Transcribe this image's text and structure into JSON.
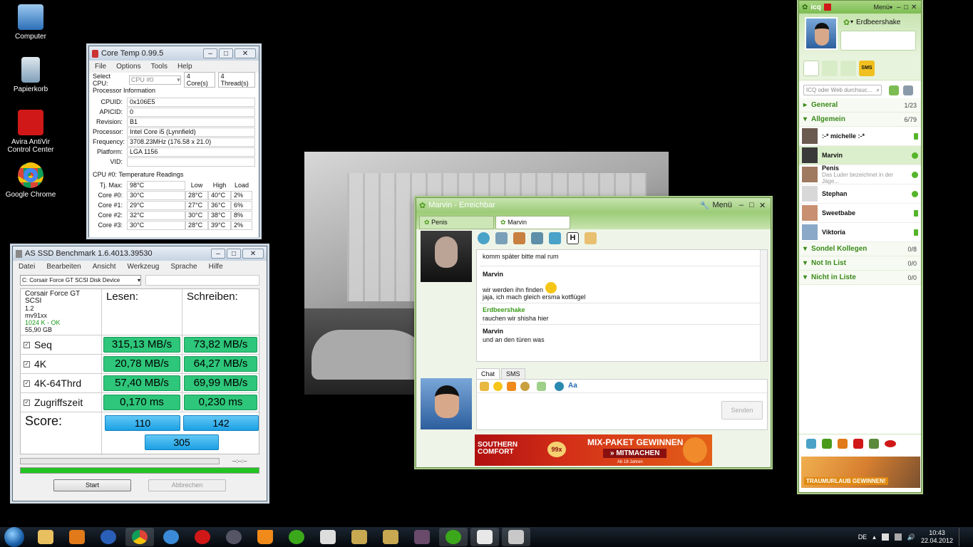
{
  "desktop": {
    "icons": [
      {
        "label": "Computer",
        "color": "#4a90d9"
      },
      {
        "label": "Papierkorb",
        "color": "#7f9fb8"
      },
      {
        "label": "Avira AntiVir Control Center",
        "color": "#d01818"
      },
      {
        "label": "Google Chrome",
        "color": "#e8b414"
      }
    ]
  },
  "coretemp": {
    "title": "Core Temp 0.99.5",
    "menu": [
      "File",
      "Options",
      "Tools",
      "Help"
    ],
    "select_cpu_label": "Select CPU:",
    "cpu_value": "CPU #0",
    "cores_count": "4",
    "cores_label": "Core(s)",
    "threads_count": "4",
    "threads_label": "Thread(s)",
    "processor_info_label": "Processor Information",
    "info": [
      {
        "label": "CPUID:",
        "value": "0x106E5"
      },
      {
        "label": "APICID:",
        "value": "0"
      },
      {
        "label": "Revision:",
        "value": "B1"
      },
      {
        "label": "Processor:",
        "value": "Intel Core i5 (Lynnfield)"
      },
      {
        "label": "Frequency:",
        "value": "3708.23MHz (176.58 x 21.0)"
      },
      {
        "label": "Platform:",
        "value": "LGA 1156"
      },
      {
        "label": "VID:",
        "value": ""
      }
    ],
    "temp_header": "CPU #0: Temperature Readings",
    "tjmax_label": "Tj. Max:",
    "tjmax_value": "98°C",
    "col_low": "Low",
    "col_high": "High",
    "col_load": "Load",
    "cores": [
      {
        "label": "Core #0:",
        "temp": "30°C",
        "low": "28°C",
        "high": "40°C",
        "load": "2%"
      },
      {
        "label": "Core #1:",
        "temp": "29°C",
        "low": "27°C",
        "high": "36°C",
        "load": "6%"
      },
      {
        "label": "Core #2:",
        "temp": "32°C",
        "low": "30°C",
        "high": "38°C",
        "load": "8%"
      },
      {
        "label": "Core #3:",
        "temp": "30°C",
        "low": "28°C",
        "high": "39°C",
        "load": "2%"
      }
    ]
  },
  "asssd": {
    "title": "AS SSD Benchmark 1.6.4013.39530",
    "menu": [
      "Datei",
      "Bearbeiten",
      "Ansicht",
      "Werkzeug",
      "Sprache",
      "Hilfe"
    ],
    "drive_select": "C: Corsair Force GT SCSI Disk Device",
    "drive_info": [
      "Corsair Force GT SCSI",
      "1.2",
      "mv91xx",
      "1024 K - OK",
      "55,90 GB"
    ],
    "col_read": "Lesen:",
    "col_write": "Schreiben:",
    "rows": [
      {
        "label": "Seq",
        "read": "315,13 MB/s",
        "write": "73,82 MB/s"
      },
      {
        "label": "4K",
        "read": "20,78 MB/s",
        "write": "64,27 MB/s"
      },
      {
        "label": "4K-64Thrd",
        "read": "57,40 MB/s",
        "write": "69,99 MB/s"
      },
      {
        "label": "Zugriffszeit",
        "read": "0,170 ms",
        "write": "0,230 ms"
      }
    ],
    "score_label": "Score:",
    "score_read": "110",
    "score_write": "142",
    "score_total": "305",
    "time_display": "--:--:--",
    "progress": 1.0,
    "start_button": "Start",
    "abort_button": "Abbrechen"
  },
  "chat": {
    "title": "Marvin - Erreichbar",
    "menu_label": "Menü",
    "tabs": [
      "Penis",
      "Marvin"
    ],
    "messages": [
      {
        "who": "",
        "text": "komm später bitte mal rum",
        "color": "#000"
      },
      {
        "who": "Marvin",
        "text": "wir werden ihn finden",
        "text2": "jaja, ich mach gleich ersma kotflügel",
        "color": "#000"
      },
      {
        "who": "Erdbeershake",
        "text": "rauchen wir shisha hier",
        "color": "#3c9a1a"
      },
      {
        "who": "Marvin",
        "text": "und an den türen was",
        "color": "#000"
      }
    ],
    "input_tabs": [
      "Chat",
      "SMS"
    ],
    "send_button": "Senden",
    "ad": {
      "brand": "SOUTHERN COMFORT",
      "badge": "99x",
      "headline": "MIX-PAKET GEWINNEN",
      "cta": "» MITMACHEN",
      "fine": "Ab 18 Jahren"
    }
  },
  "icq": {
    "app_name": "icq",
    "menu_label": "Menü",
    "user_name": "Erdbeershake",
    "search_placeholder": "ICQ oder Web durchsuc...",
    "groups": [
      {
        "name": "General",
        "count": "1/23",
        "expanded": false
      },
      {
        "name": "Allgemein",
        "count": "6/79",
        "expanded": true
      }
    ],
    "contacts": [
      {
        "name": ":-* michelle :-*",
        "sub": "",
        "status": "mobile"
      },
      {
        "name": "Marvin",
        "sub": "",
        "status": "online"
      },
      {
        "name": "Penis",
        "sub": "Das Luder bezeichnet in der Jäge...",
        "status": "online"
      },
      {
        "name": "Stephan",
        "sub": "",
        "status": "online"
      },
      {
        "name": "Sweetbabe",
        "sub": "",
        "status": "mobile"
      },
      {
        "name": "Viktoria",
        "sub": "",
        "status": "mobile"
      }
    ],
    "groups_after": [
      {
        "name": "Sondel Kollegen",
        "count": "0/8"
      },
      {
        "name": "Not In List",
        "count": "0/0"
      },
      {
        "name": "Nicht in Liste",
        "count": "0/0"
      }
    ],
    "ad_text": "TRAUMURLAUB GEWINNEN!"
  },
  "taskbar": {
    "language": "DE",
    "time": "10:43",
    "date": "22.04.2012"
  }
}
